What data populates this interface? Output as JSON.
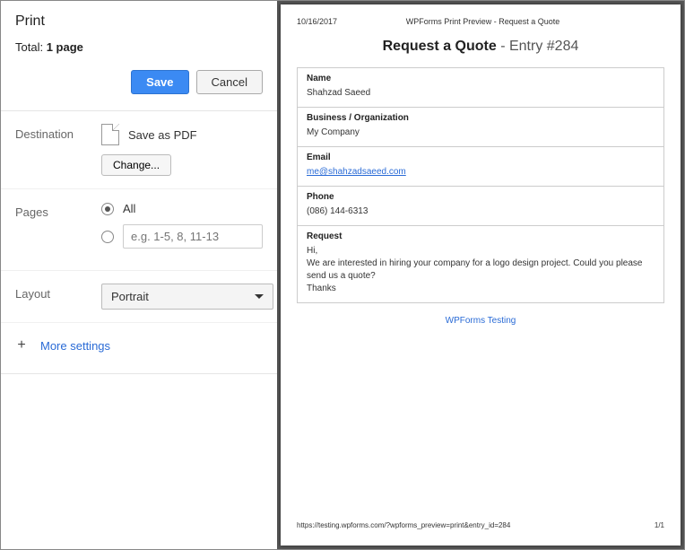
{
  "header": {
    "title": "Print",
    "total_prefix": "Total: ",
    "total_value": "1 page"
  },
  "buttons": {
    "save": "Save",
    "cancel": "Cancel"
  },
  "destination": {
    "label": "Destination",
    "option": "Save as PDF",
    "change": "Change..."
  },
  "pages": {
    "label": "Pages",
    "all": "All",
    "placeholder": "e.g. 1-5, 8, 11-13"
  },
  "layout": {
    "label": "Layout",
    "value": "Portrait"
  },
  "more": {
    "label": "More settings"
  },
  "preview": {
    "date": "10/16/2017",
    "doctitle": "WPForms Print Preview - Request a Quote",
    "title_bold": "Request a Quote",
    "title_light": " - Entry #284",
    "fields": {
      "name_label": "Name",
      "name_value": "Shahzad Saeed",
      "biz_label": "Business / Organization",
      "biz_value": "My Company",
      "email_label": "Email",
      "email_value": "me@shahzadsaeed.com",
      "phone_label": "Phone",
      "phone_value": "(086) 144-6313",
      "request_label": "Request",
      "request_value": "Hi,\nWe are interested in hiring your company for a logo design project. Could you please send us a quote?\nThanks"
    },
    "footer_link": "WPForms Testing",
    "url": "https://testing.wpforms.com/?wpforms_preview=print&entry_id=284",
    "pagenum": "1/1"
  }
}
